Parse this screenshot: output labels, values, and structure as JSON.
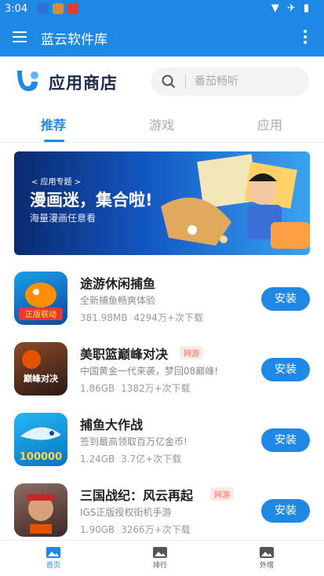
{
  "status_bar": {
    "time": "3:04",
    "system_icons": "▼ ✈ ▮"
  },
  "app_bar": {
    "title": "蓝云软件库"
  },
  "store": {
    "name": "应用商店",
    "search_placeholder": "番茄畅听"
  },
  "tabs": [
    {
      "label": "推荐",
      "active": true
    },
    {
      "label": "游戏",
      "active": false
    },
    {
      "label": "应用",
      "active": false
    }
  ],
  "banner": {
    "tag": "< 应用专题 >",
    "headline": "漫画迷，集合啦!",
    "subtitle": "海量漫画任意看"
  },
  "apps": [
    {
      "name": "途游休闲捕鱼",
      "badge": "",
      "desc": "全新捕鱼畅爽体验",
      "size": "381.98MB",
      "downloads": "4294万+次下载",
      "action": "安装",
      "icon_text": "正版联动"
    },
    {
      "name": "美职篮巅峰对决",
      "badge": "网游",
      "desc": "中国黄金一代来袭，梦回08巅峰!",
      "size": "1.86GB",
      "downloads": "1382万+次下载",
      "action": "安装",
      "icon_text": "巅峰对决"
    },
    {
      "name": "捕鱼大作战",
      "badge": "",
      "desc": "签到最高领取百万亿金币!",
      "size": "1.24GB",
      "downloads": "3.7亿+次下载",
      "action": "安装",
      "icon_text": "100000"
    },
    {
      "name": "三国战纪：风云再起",
      "badge": "网游",
      "desc": "IGS正版授权街机手游",
      "size": "1.90GB",
      "downloads": "3266万+次下载",
      "action": "安装",
      "icon_text": ""
    }
  ],
  "bottom_nav": [
    {
      "label": "首页",
      "active": true
    },
    {
      "label": "排行",
      "active": false
    },
    {
      "label": "外增",
      "active": false
    }
  ],
  "colors": {
    "primary": "#1e88e5",
    "badge": "#ff6b5b"
  }
}
